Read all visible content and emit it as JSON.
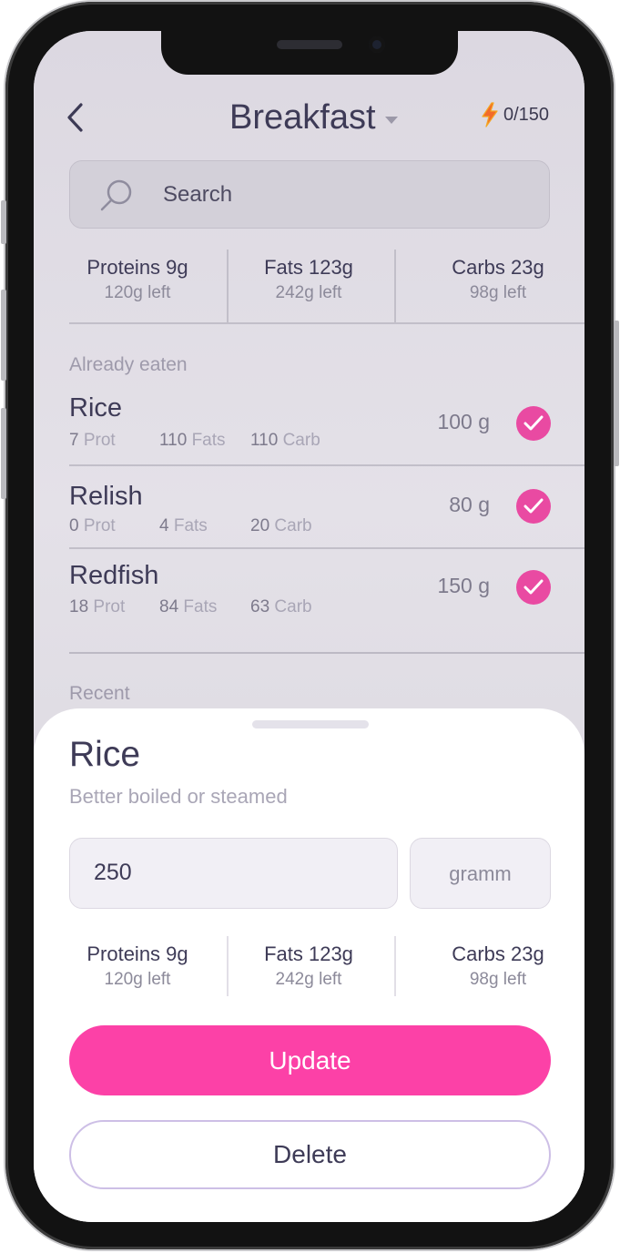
{
  "header": {
    "title": "Breakfast",
    "energy": "0/150",
    "back_icon": "chevron-left-icon",
    "energy_icon": "lightning-icon"
  },
  "search": {
    "placeholder": "Search",
    "icon": "search-icon"
  },
  "summary": {
    "proteins": {
      "label": "Proteins 9g",
      "left": "120g left"
    },
    "fats": {
      "label": "Fats 123g",
      "left": "242g left"
    },
    "carbs": {
      "label": "Carbs 23g",
      "left": "98g left"
    }
  },
  "already_eaten": {
    "label": "Already eaten",
    "items": [
      {
        "name": "Rice",
        "prot": "7",
        "fats": "110",
        "carb": "110",
        "qty": "100 g"
      },
      {
        "name": "Relish",
        "prot": "0",
        "fats": "4",
        "carb": "20",
        "qty": "80 g"
      },
      {
        "name": "Redfish",
        "prot": "18",
        "fats": "84",
        "carb": "63",
        "qty": "150 g"
      }
    ],
    "unit_labels": {
      "prot": "Prot",
      "fats": "Fats",
      "carb": "Carb"
    }
  },
  "recent": {
    "label": "Recent"
  },
  "sheet": {
    "title": "Rice",
    "subtitle": "Better boiled or steamed",
    "amount": "250",
    "unit": "gramm",
    "proteins": {
      "label": "Proteins 9g",
      "left": "120g left"
    },
    "fats": {
      "label": "Fats 123g",
      "left": "242g left"
    },
    "carbs": {
      "label": "Carbs 23g",
      "left": "98g left"
    },
    "update_label": "Update",
    "delete_label": "Delete"
  },
  "colors": {
    "accent": "#fc41a7",
    "check": "#e94aa2",
    "text": "#3e3b57",
    "energy": "#f26a2a"
  }
}
